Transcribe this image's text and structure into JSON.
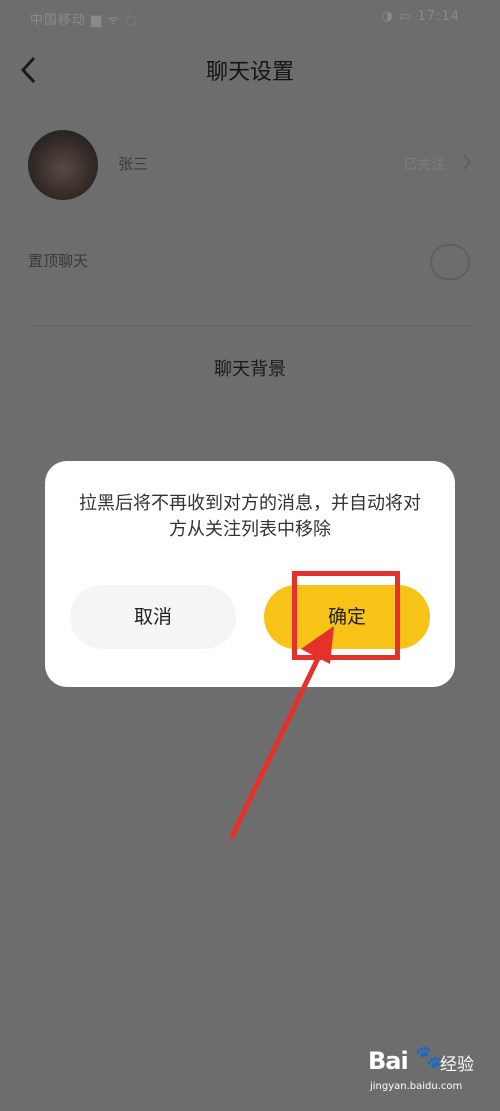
{
  "status_bar": {
    "left_text": "中国移动 ▆ ᯤ ◌",
    "right_text": "◑ ▭ 17:14"
  },
  "header": {
    "title": "聊天设置"
  },
  "profile": {
    "name": "张三",
    "status": "已关注"
  },
  "settings": {
    "row_label": "置顶聊天",
    "background_label": "聊天背景"
  },
  "dialog": {
    "message": "拉黑后将不再收到对方的消息，并自动将对方从关注列表中移除",
    "cancel_label": "取消",
    "confirm_label": "确定"
  },
  "colors": {
    "accent": "#f7c317",
    "annotation": "#e4312b",
    "overlay": "#6d6d6d"
  },
  "watermark": {
    "logo": "Bai",
    "paw": "🐾",
    "text": "经验",
    "url": "jingyan.baidu.com"
  }
}
